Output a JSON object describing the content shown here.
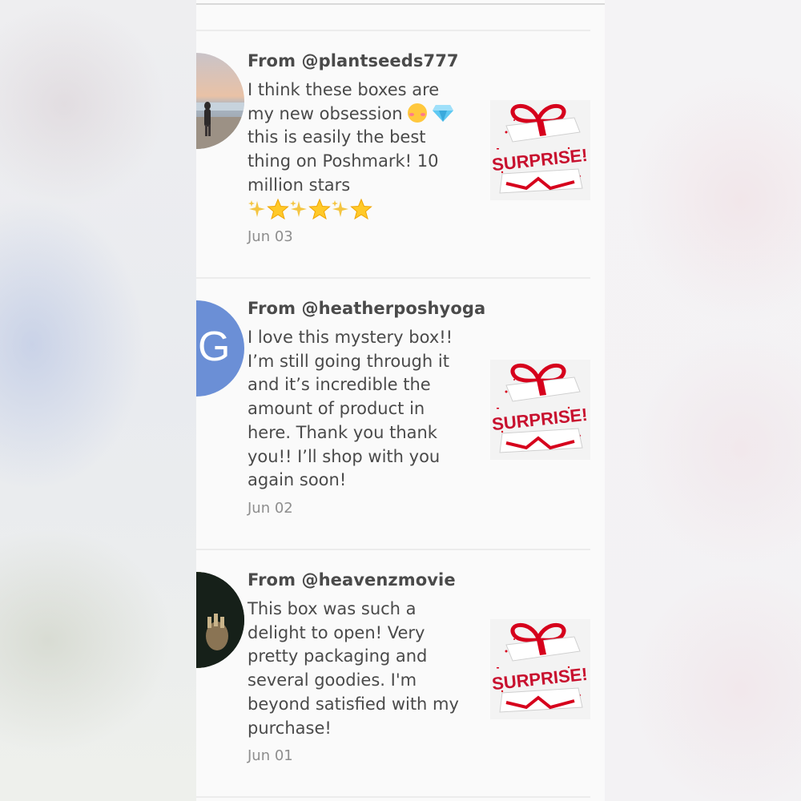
{
  "reviews": [
    {
      "from": "From @plantseeds777",
      "text_before_emoji": "I think these boxes are my new obsession ",
      "text_after_emoji": "this is easily the best thing on Poshmark! 10 million stars",
      "emoji_icons": [
        "smiling-face-with-hearts-icon",
        "gem-icon"
      ],
      "star_icons": [
        "sparkles-icon",
        "star-icon",
        "sparkles-icon",
        "star-icon",
        "sparkles-icon",
        "star-icon"
      ],
      "date": "Jun 03",
      "avatar": "beach-photo-avatar",
      "thumbnail_text": "SURPRISE!"
    },
    {
      "from": "From @heatherposhyoga",
      "text": "I love this mystery box!! I’m still going through it and it’s incredible the amount of product in here. Thank you thank you!! I’ll shop with you again soon!",
      "date": "Jun 02",
      "avatar_letter": "G",
      "avatar_color": "#6b8fd6",
      "thumbnail_text": "SURPRISE!"
    },
    {
      "from": "From @heavenzmovie",
      "text": "This box was such a delight to open! Very pretty packaging and several goodies. I'm beyond satisfied with my purchase!",
      "date": "Jun 01",
      "avatar": "dark-photo-avatar",
      "thumbnail_text": "SURPRISE!"
    }
  ],
  "colors": {
    "text": "#4a4a4a",
    "date": "#8e8e8e",
    "surprise_red": "#c8102e"
  }
}
